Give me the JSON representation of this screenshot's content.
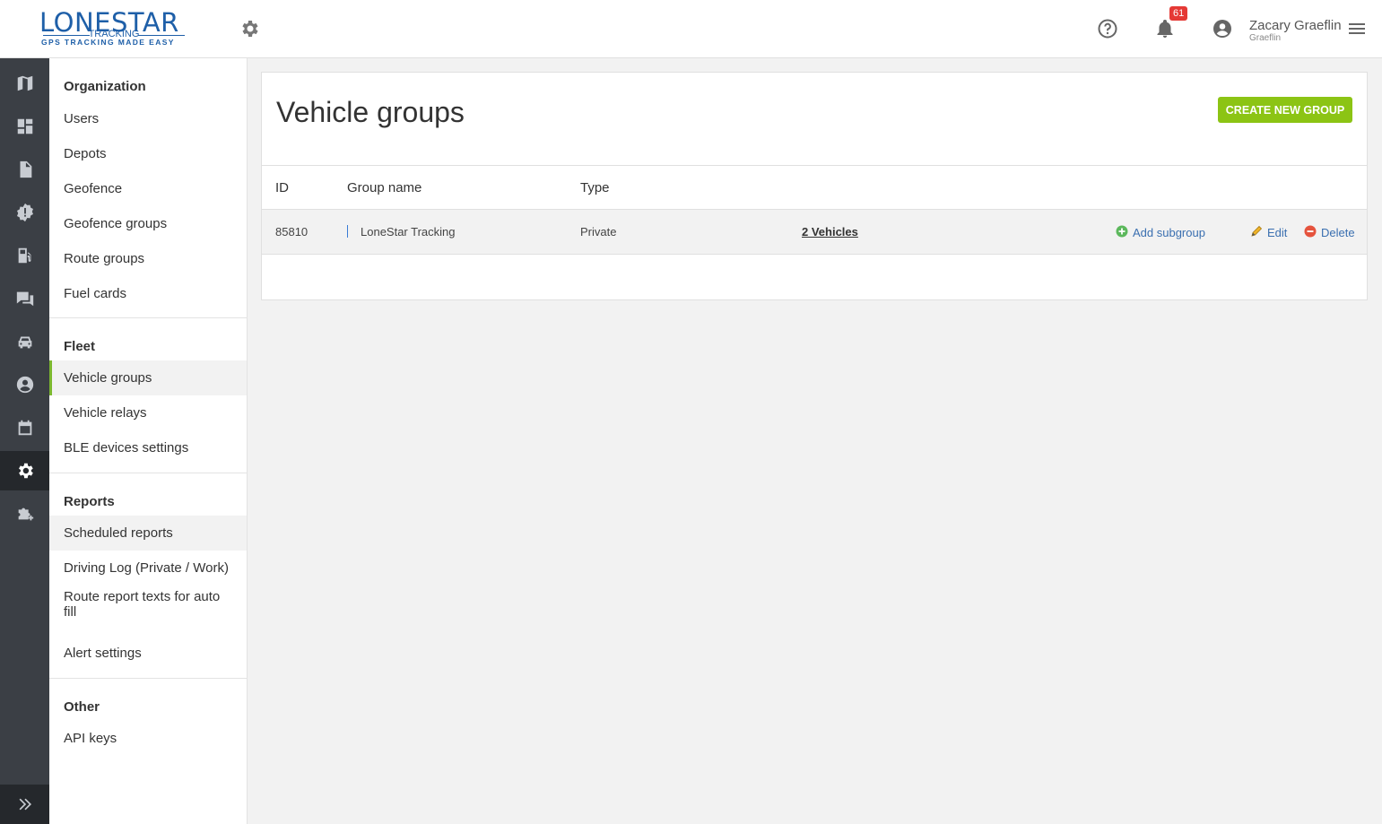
{
  "header": {
    "logo": {
      "main": "LONESTAR",
      "sub": "TRACKING",
      "tagline": "GPS TRACKING MADE EASY"
    },
    "notifications_count": "61",
    "user": {
      "name": "Zacary Graeflin",
      "org": "Graeflin"
    }
  },
  "rail": {
    "items": [
      "map-icon",
      "dashboard-icon",
      "document-icon",
      "alert-badge-icon",
      "fuel-icon",
      "chat-icon",
      "car-icon",
      "person-icon",
      "calendar-icon",
      "settings-gear-icon",
      "puzzle-icon"
    ],
    "active": "settings-gear-icon",
    "expand_icon": "double-chevron-right-icon"
  },
  "nav": {
    "organization": {
      "heading": "Organization",
      "items": [
        "Users",
        "Depots",
        "Geofence",
        "Geofence groups",
        "Route groups",
        "Fuel cards"
      ]
    },
    "fleet": {
      "heading": "Fleet",
      "items": [
        "Vehicle groups",
        "Vehicle relays",
        "BLE devices settings"
      ]
    },
    "reports": {
      "heading": "Reports",
      "items": [
        "Scheduled reports",
        "Driving Log (Private / Work)",
        "Route report texts for auto fill",
        "Alert settings"
      ]
    },
    "other": {
      "heading": "Other",
      "items": [
        "API keys"
      ]
    },
    "active_item": "Vehicle groups"
  },
  "main": {
    "title": "Vehicle groups",
    "create_button": "CREATE NEW GROUP",
    "table": {
      "columns": [
        "ID",
        "Group name",
        "Type"
      ],
      "rows": [
        {
          "id": "85810",
          "name": "LoneStar Tracking",
          "type": "Private",
          "vehicles": "2 Vehicles",
          "add_subgroup": "Add subgroup",
          "edit": "Edit",
          "delete": "Delete"
        }
      ]
    }
  },
  "colors": {
    "accent_green": "#8cc414",
    "rail_bg": "#3b3f45",
    "link_blue": "#3a6fb0",
    "badge_red": "#e53935"
  }
}
